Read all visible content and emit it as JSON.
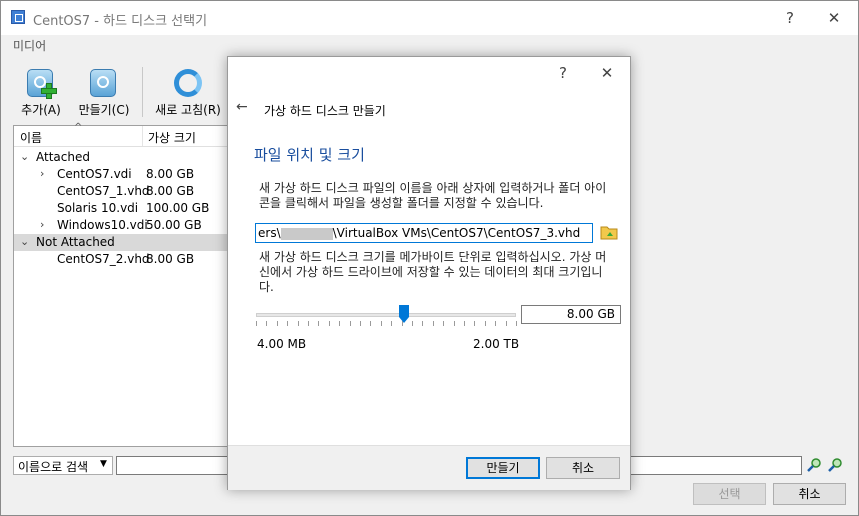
{
  "window": {
    "title": "CentOS7 - 하드 디스크 선택기",
    "help": "?",
    "close": "✕"
  },
  "menu": [
    "미디어"
  ],
  "toolbar": {
    "add": "추가(A)",
    "create": "만들기(C)",
    "refresh": "새로 고침(R)"
  },
  "tree": {
    "columns": {
      "name": "이름",
      "size": "가상 크기"
    },
    "groups": [
      {
        "label": "Attached",
        "items": [
          {
            "name": "CentOS7.vdi",
            "size": "8.00 GB",
            "expandable": true
          },
          {
            "name": "CentOS7_1.vhd",
            "size": "8.00 GB",
            "expandable": false
          },
          {
            "name": "Solaris 10.vdi",
            "size": "100.00 GB",
            "expandable": false
          },
          {
            "name": "Windows10.vdi",
            "size": "50.00 GB",
            "expandable": true
          }
        ]
      },
      {
        "label": "Not Attached",
        "items": [
          {
            "name": "CentOS7_2.vhd",
            "size": "8.00 GB",
            "expandable": false
          }
        ]
      }
    ]
  },
  "search": {
    "mode": "이름으로 검색",
    "value": ""
  },
  "bottom_buttons": {
    "select": "선택",
    "cancel": "취소"
  },
  "dialog": {
    "help": "?",
    "close": "✕",
    "back": "←",
    "title": "가상 하드 디스크 만들기",
    "heading": "파일 위치 및 크기",
    "location_text": "새 가상 하드 디스크 파일의 이름을 아래 상자에 입력하거나 폴더 아이콘을 클릭해서 파일을 생성할 폴더를 지정할 수 있습니다.",
    "path_prefix": "ers\\",
    "path_suffix": "\\VirtualBox VMs\\CentOS7\\CentOS7_3.vhd",
    "size_text": "새 가상 하드 디스크 크기를 메가바이트 단위로 입력하십시오. 가상 머신에서 가상 하드 드라이브에 저장할 수 있는 데이터의 최대 크기입니다.",
    "size_value": "8.00 GB",
    "slider_min": "4.00 MB",
    "slider_max": "2.00 TB",
    "slider_position": 0.57,
    "create": "만들기",
    "cancel": "취소"
  },
  "colors": {
    "accent": "#0078d7",
    "heading": "#1a4e9e"
  }
}
